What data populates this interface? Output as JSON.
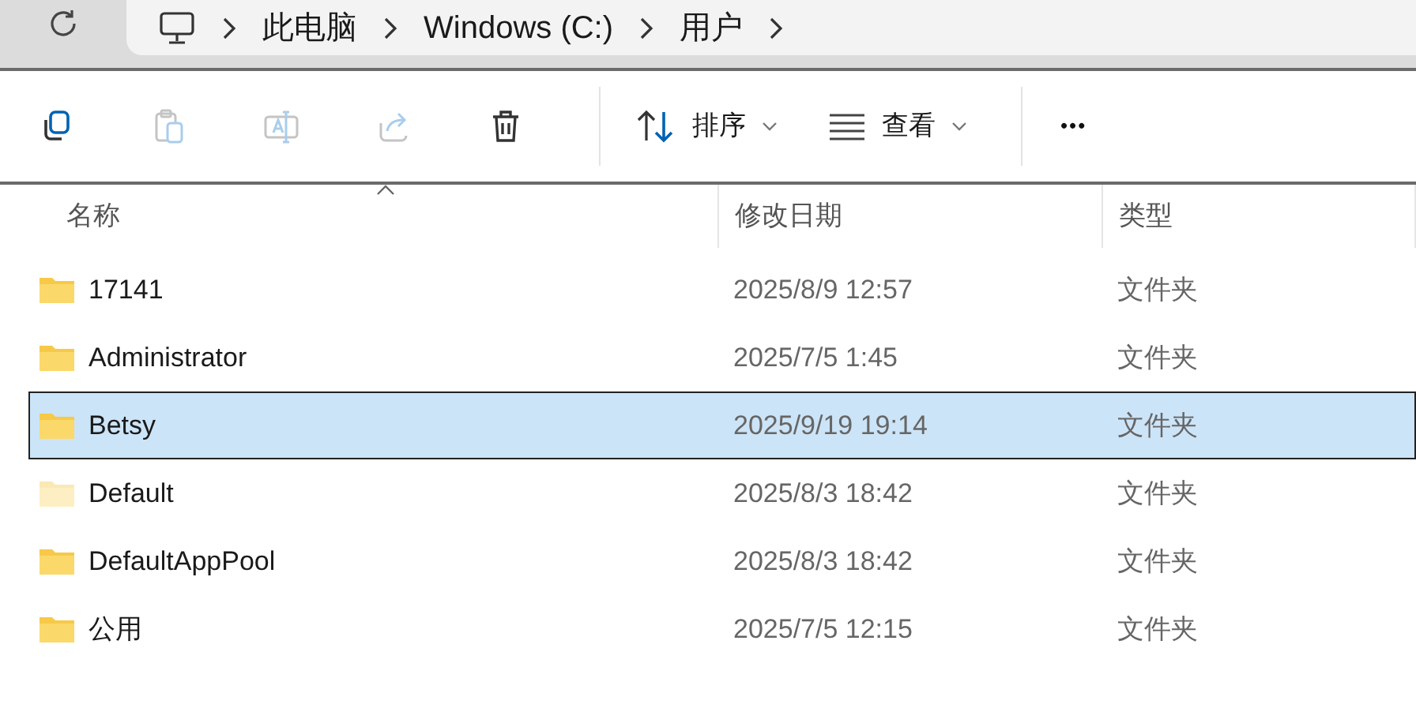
{
  "breadcrumb": [
    "此电脑",
    "Windows (C:)",
    "用户"
  ],
  "toolbar": [
    {
      "kind": "copy",
      "disabled": false
    },
    {
      "kind": "paste",
      "disabled": true
    },
    {
      "kind": "rename",
      "disabled": true
    },
    {
      "kind": "share",
      "disabled": true
    },
    {
      "kind": "delete",
      "disabled": false
    }
  ],
  "menus": [
    {
      "kind": "sort",
      "label": "排序"
    },
    {
      "kind": "view",
      "label": "查看"
    }
  ],
  "more": "•••",
  "columns": [
    "名称",
    "修改日期",
    "类型"
  ],
  "rows": [
    {
      "name": "17141",
      "date": "2025/8/9 12:57",
      "type": "文件夹",
      "selected": false,
      "hidden": false
    },
    {
      "name": "Administrator",
      "date": "2025/7/5 1:45",
      "type": "文件夹",
      "selected": false,
      "hidden": false
    },
    {
      "name": "Betsy",
      "date": "2025/9/19 19:14",
      "type": "文件夹",
      "selected": true,
      "hidden": false
    },
    {
      "name": "Default",
      "date": "2025/8/3 18:42",
      "type": "文件夹",
      "selected": false,
      "hidden": true
    },
    {
      "name": "DefaultAppPool",
      "date": "2025/8/3 18:42",
      "type": "文件夹",
      "selected": false,
      "hidden": false
    },
    {
      "name": "公用",
      "date": "2025/7/5 12:15",
      "type": "文件夹",
      "selected": false,
      "hidden": false
    }
  ]
}
